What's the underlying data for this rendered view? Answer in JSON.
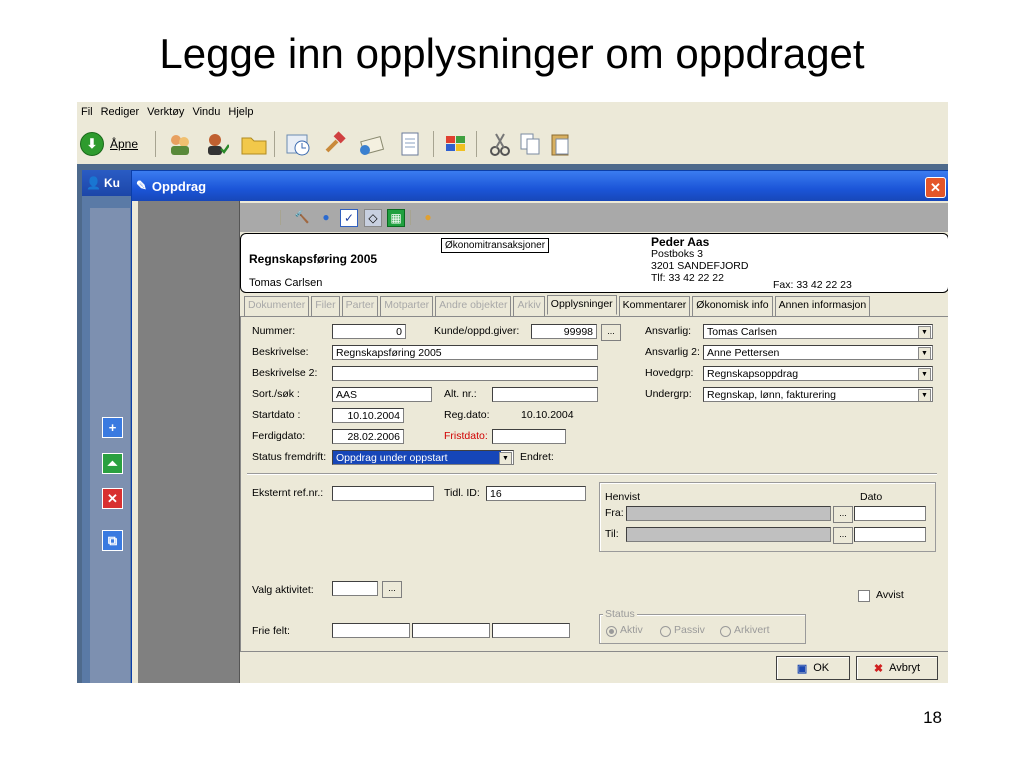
{
  "slide": {
    "title": "Legge inn opplysninger om oppdraget",
    "page_number": "18"
  },
  "menu": [
    "Fil",
    "Rediger",
    "Verktøy",
    "Vindu",
    "Hjelp"
  ],
  "toolbar": {
    "open_label": "Åpne"
  },
  "behind_window": {
    "title": "Ku"
  },
  "window": {
    "title": "Oppdrag"
  },
  "info": {
    "project": "Regnskapsføring 2005",
    "responsible": "Tomas Carlsen",
    "tooltip": "Økonomitransaksjoner",
    "customer_name": "Peder Aas",
    "customer_address1": "Postboks 3",
    "customer_address2": "3201 SANDEFJORD",
    "customer_phone": "Tlf: 33 42 22 22",
    "customer_fax": "Fax: 33 42 22 23"
  },
  "tabs": [
    {
      "label": "Dokumenter",
      "state": "disabled"
    },
    {
      "label": "Filer",
      "state": "disabled"
    },
    {
      "label": "Parter",
      "state": "disabled"
    },
    {
      "label": "Motparter",
      "state": "disabled"
    },
    {
      "label": "Andre objekter",
      "state": "disabled"
    },
    {
      "label": "Arkiv",
      "state": "disabled"
    },
    {
      "label": "Opplysninger",
      "state": "active"
    },
    {
      "label": "Kommentarer",
      "state": "normal"
    },
    {
      "label": "Økonomisk info",
      "state": "normal"
    },
    {
      "label": "Annen informasjon",
      "state": "normal"
    }
  ],
  "form": {
    "nummer_label": "Nummer:",
    "nummer_value": "0",
    "kunde_label": "Kunde/oppd.giver:",
    "kunde_value": "99998",
    "beskrivelse_label": "Beskrivelse:",
    "beskrivelse_value": "Regnskapsføring 2005",
    "beskrivelse2_label": "Beskrivelse 2:",
    "beskrivelse2_value": "",
    "sort_label": "Sort./søk :",
    "sort_value": "AAS",
    "altnr_label": "Alt. nr.:",
    "altnr_value": "",
    "startdato_label": "Startdato :",
    "startdato_value": "10.10.2004",
    "regdato_label": "Reg.dato:",
    "regdato_value": "10.10.2004",
    "ferdigdato_label": "Ferdigdato:",
    "ferdigdato_value": "28.02.2006",
    "fristdato_label": "Fristdato:",
    "fristdato_value": "",
    "status_label": "Status fremdrift:",
    "status_value": "Oppdrag under oppstart",
    "endret_label": "Endret:",
    "ansvarlig_label": "Ansvarlig:",
    "ansvarlig_value": "Tomas Carlsen",
    "ansvarlig2_label": "Ansvarlig 2:",
    "ansvarlig2_value": "Anne Pettersen",
    "hovedgrp_label": "Hovedgrp:",
    "hovedgrp_value": "Regnskapsoppdrag",
    "undergrp_label": "Undergrp:",
    "undergrp_value": "Regnskap, lønn, fakturering",
    "eksternt_label": "Eksternt ref.nr.:",
    "eksternt_value": "",
    "tidlid_label": "Tidl. ID:",
    "tidlid_value": "16",
    "henvist_label": "Henvist",
    "dato_label": "Dato",
    "fra_label": "Fra:",
    "til_label": "Til:",
    "valg_label": "Valg aktivitet:",
    "avvist_label": "Avvist",
    "frie_label": "Frie felt:",
    "status_group_label": "Status",
    "radio_aktiv": "Aktiv",
    "radio_passiv": "Passiv",
    "radio_arkivert": "Arkivert",
    "dots": "..."
  },
  "buttons": {
    "ok": "OK",
    "cancel": "Avbryt"
  }
}
